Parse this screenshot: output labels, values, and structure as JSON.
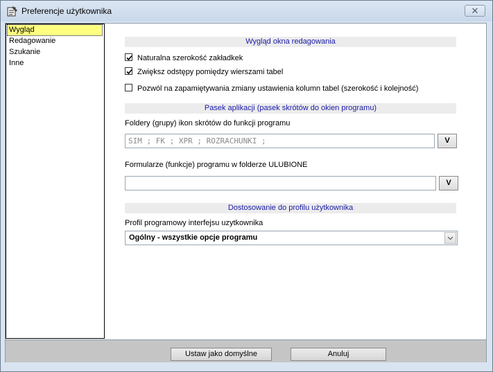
{
  "window": {
    "title": "Preferencje użytkownika",
    "close_icon": "close-icon"
  },
  "nav": {
    "items": [
      {
        "label": "Wygląd",
        "selected": true
      },
      {
        "label": "Redagowanie",
        "selected": false
      },
      {
        "label": "Szukanie",
        "selected": false
      },
      {
        "label": "Inne",
        "selected": false
      }
    ]
  },
  "sections": {
    "view": "Wygląd okna redagowania",
    "appbar": "Pasek aplikacji (pasek skrótów do okien programu)",
    "profile": "Dostosowanie do profilu użytkownika"
  },
  "options": {
    "natural_width": {
      "label": "Naturalna szerokość zakładkek",
      "checked": true
    },
    "row_spacing": {
      "label": "Zwiększ odstępy pomiędzy wierszami tabel",
      "checked": true
    },
    "remember_columns": {
      "label": "Pozwól na zapamiętywania zmiany ustawienia kolumn tabel (szerokość i kolejność)",
      "checked": false
    }
  },
  "folders": {
    "label": "Foldery (grupy) ikon skrótów do funkcji programu",
    "value": "SIM ; FK ; XPR ; ROZRACHUNKI ;",
    "button": "V"
  },
  "favorites": {
    "label": "Formularze (funkcje) programu w folderze ULUBIONE",
    "value": "",
    "button": "V"
  },
  "profile": {
    "label": "Profil programowy interfejsu uzytkownika",
    "selected": "Ogólny - wszystkie opcje programu"
  },
  "footer": {
    "set_default": "Ustaw jako domyślne",
    "cancel": "Anuluj"
  },
  "colors": {
    "selection": "#ffff80",
    "section_header_text": "#1a1aa6",
    "section_header_bg": "#ececec"
  }
}
